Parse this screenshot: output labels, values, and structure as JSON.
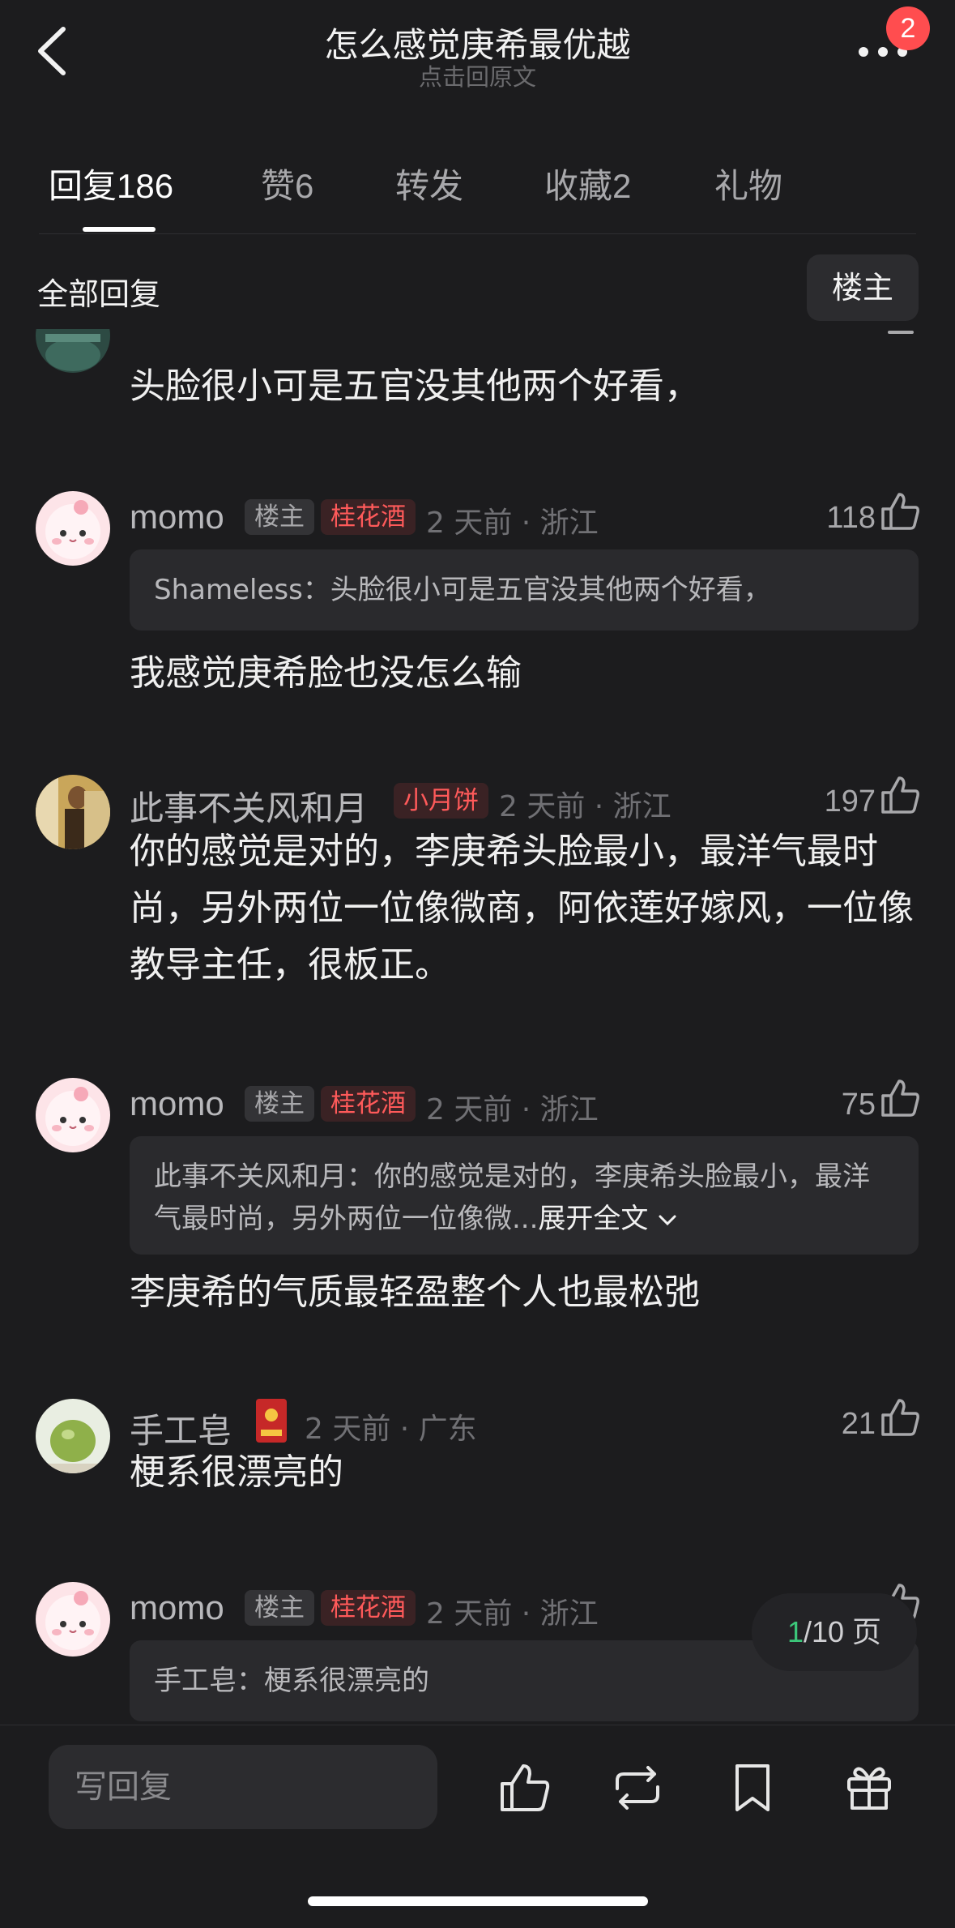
{
  "header": {
    "title": "怎么感觉庚希最优越",
    "subtitle": "点击回原文",
    "notification_count": "2"
  },
  "tabs": [
    {
      "label": "回复",
      "count": "186"
    },
    {
      "label": "赞",
      "count": "6"
    },
    {
      "label": "转发",
      "count": ""
    },
    {
      "label": "收藏",
      "count": "2"
    },
    {
      "label": "礼物",
      "count": ""
    }
  ],
  "filter": {
    "label": "全部回复",
    "button": "楼主"
  },
  "partial_comment": {
    "text": "头脸很小可是五官没其他两个好看，"
  },
  "comments": [
    {
      "user": "momo",
      "host_badge": "楼主",
      "gift_badge": "桂花酒",
      "meta": "2 天前 · 浙江",
      "likes": "118",
      "quote": "Shameless：头脸很小可是五官没其他两个好看，",
      "text": "我感觉庚希脸也没怎么输"
    },
    {
      "user": "此事不关风和月",
      "gift_badge": "小月饼",
      "meta": "2 天前 · 浙江",
      "likes": "197",
      "text": "你的感觉是对的，李庚希头脸最小，最洋气最时尚，另外两位一位像微商，阿依莲好嫁风，一位像教导主任，很板正。"
    },
    {
      "user": "momo",
      "host_badge": "楼主",
      "gift_badge": "桂花酒",
      "meta": "2 天前 · 浙江",
      "likes": "75",
      "quote": "此事不关风和月：你的感觉是对的，李庚希头脸最小，最洋气最时尚，另外两位一位像微...",
      "expand": "展开全文",
      "text": "李庚希的气质最轻盈整个人也最松弛"
    },
    {
      "user": "手工皂",
      "meta": "2 天前 · 广东",
      "likes": "21",
      "text": "梗系很漂亮的"
    },
    {
      "user": "momo",
      "host_badge": "楼主",
      "gift_badge": "桂花酒",
      "meta": "2 天前 · 浙江",
      "quote": "手工皂：梗系很漂亮的"
    }
  ],
  "pager": {
    "current": "1",
    "total": "/10 页"
  },
  "bottom_bar": {
    "reply_placeholder": "写回复"
  },
  "colors": {
    "background": "#1c1c1e",
    "card": "#2a2a2d",
    "badge_red": "#ff5a5a",
    "notification": "#ff4d4f",
    "pager_current": "#3cc77a"
  }
}
